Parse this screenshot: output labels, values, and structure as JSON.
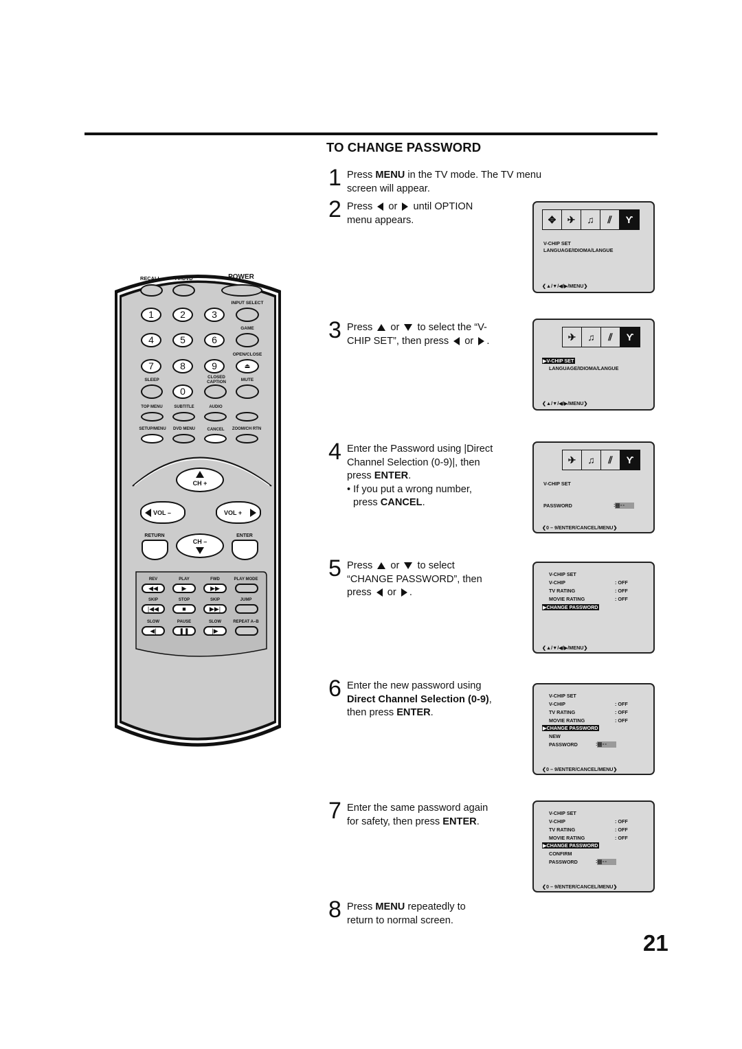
{
  "page": {
    "section_title": "TO CHANGE PASSWORD",
    "page_number": "21"
  },
  "steps": [
    {
      "num": "1",
      "lines": [
        "Press |MENU| in the TV mode. The TV menu",
        "screen will appear."
      ]
    },
    {
      "num": "2",
      "lines": [
        "Press [L] or [R] until OPTION",
        "menu appears."
      ]
    },
    {
      "num": "3",
      "lines": [
        "Press [U] or [D] to select the “V-",
        "CHIP SET”, then press [L] or [R]."
      ]
    },
    {
      "num": "4",
      "lines": [
        "Enter the Password using |Direct",
        "Channel Selection (0-9)|, then",
        "press |ENTER|.",
        "• If you put a wrong number,",
        "  press |CANCEL|."
      ]
    },
    {
      "num": "5",
      "lines": [
        "Press [U] or [D] to select",
        "“CHANGE PASSWORD”, then",
        "press [L] or [R]."
      ]
    },
    {
      "num": "6",
      "lines": [
        "Enter the new password using",
        "|Direct Channel Selection (0-9)|,",
        "then press |ENTER|."
      ]
    },
    {
      "num": "7",
      "lines": [
        "Enter the same password again",
        "for safety, then press |ENTER|."
      ]
    },
    {
      "num": "8",
      "lines": [
        "Press |MENU| repeatedly to",
        "return to normal screen."
      ]
    }
  ],
  "screens": {
    "s1": {
      "icons": [
        "move-icon",
        "picture-icon",
        "audio-icon",
        "antenna-icon",
        "tools-icon"
      ],
      "items": [
        "V-CHIP SET",
        "LANGUAGE/IDIOMA/LANGUE"
      ],
      "footer": "/MENU"
    },
    "s2": {
      "icons": [
        "picture-icon",
        "audio-icon",
        "antenna-icon",
        "tools-icon"
      ],
      "selected": "V-CHIP SET",
      "items": [
        "LANGUAGE/IDIOMA/LANGUE"
      ],
      "footer": "/MENU"
    },
    "s3": {
      "icons": [
        "picture-icon",
        "audio-icon",
        "antenna-icon",
        "tools-icon"
      ],
      "title": "V-CHIP SET",
      "password_label": "PASSWORD",
      "password_value": "----",
      "footer": "0 – 9/ENTER/CANCEL/MENU"
    },
    "s4": {
      "title": "V-CHIP SET",
      "rows": [
        {
          "label": "V-CHIP",
          "value": ": OFF"
        },
        {
          "label": "TV RATING",
          "value": ": OFF"
        },
        {
          "label": "MOVIE RATING",
          "value": ": OFF"
        }
      ],
      "selected": "CHANGE PASSWORD",
      "footer": "/MENU"
    },
    "s5": {
      "title": "V-CHIP SET",
      "rows": [
        {
          "label": "V-CHIP",
          "value": ": OFF"
        },
        {
          "label": "TV RATING",
          "value": ": OFF"
        },
        {
          "label": "MOVIE RATING",
          "value": ": OFF"
        }
      ],
      "selected": "CHANGE PASSWORD",
      "sub1": "NEW",
      "sub2": "PASSWORD",
      "password_value": "----",
      "footer": "0 – 9/ENTER/CANCEL/MENU"
    },
    "s6": {
      "title": "V-CHIP SET",
      "rows": [
        {
          "label": "V-CHIP",
          "value": ": OFF"
        },
        {
          "label": "TV RATING",
          "value": ": OFF"
        },
        {
          "label": "MOVIE RATING",
          "value": ": OFF"
        }
      ],
      "selected": "CHANGE PASSWORD",
      "sub1": "CONFIRM",
      "sub2": "PASSWORD",
      "password_value": "----",
      "footer": "0 – 9/ENTER/CANCEL/MENU"
    }
  },
  "remote": {
    "labels": {
      "recall": "RECALL",
      "tvdvd": "TV/DVD",
      "power": "POWER",
      "input_select": "INPUT SELECT",
      "game": "GAME",
      "open_close": "OPEN/CLOSE",
      "sleep": "SLEEP",
      "closed": "CLOSED",
      "caption": "CAPTION",
      "mute": "MUTE",
      "top_menu": "TOP MENU",
      "subtitle": "SUBTITLE",
      "audio": "AUDIO",
      "setup_menu": "SETUP/MENU",
      "dvd_menu": "DVD MENU",
      "cancel": "CANCEL",
      "zoom_ch_rtn": "ZOOM/CH RTN",
      "ch_plus": "CH +",
      "ch_minus": "CH –",
      "vol_minus": "VOL –",
      "vol_plus": "VOL +",
      "return": "RETURN",
      "enter": "ENTER",
      "rev": "REV",
      "play": "PLAY",
      "fwd": "FWD",
      "play_mode": "PLAY MODE",
      "skip_back": "SKIP",
      "stop": "STOP",
      "skip_fwd": "SKIP",
      "jump": "JUMP",
      "slow_back": "SLOW",
      "pause": "PAUSE",
      "slow_fwd": "SLOW",
      "repeat_ab": "REPEAT A–B"
    },
    "digits": [
      "1",
      "2",
      "3",
      "4",
      "5",
      "6",
      "7",
      "8",
      "9",
      "0"
    ]
  },
  "colors": {
    "ink": "#111111",
    "panel": "#cccccc",
    "screen": "#d9d9d9"
  }
}
